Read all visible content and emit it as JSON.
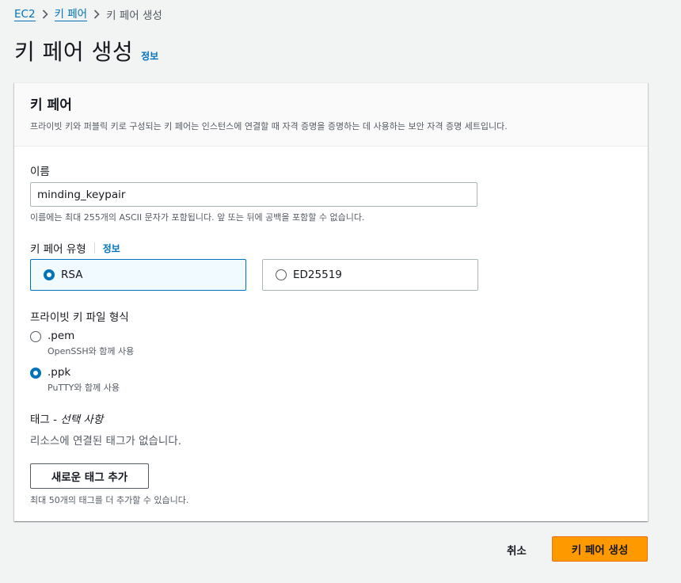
{
  "breadcrumb": {
    "root": "EC2",
    "parent": "키 페어",
    "current": "키 페어 생성"
  },
  "page": {
    "title": "키 페어 생성",
    "info": "정보"
  },
  "section": {
    "title": "키 페어",
    "description": "프라이빗 키와 퍼블릭 키로 구성되는 키 페어는 인스턴스에 연결할 때 자격 증명을 증명하는 데 사용하는 보안 자격 증명 세트입니다."
  },
  "name_field": {
    "label": "이름",
    "value": "minding_keypair",
    "hint": "이름에는 최대 255개의 ASCII 문자가 포함됩니다. 앞 또는 뒤에 공백을 포함할 수 없습니다."
  },
  "key_type": {
    "label": "키 페어 유형",
    "info": "정보",
    "options": [
      "RSA",
      "ED25519"
    ],
    "selected": "RSA"
  },
  "file_format": {
    "label": "프라이빗 키 파일 형식",
    "options": [
      {
        "label": ".pem",
        "sub": "OpenSSH와 함께 사용"
      },
      {
        "label": ".ppk",
        "sub": "PuTTY와 함께 사용"
      }
    ],
    "selected": ".ppk"
  },
  "tags": {
    "label": "태그 - ",
    "label_optional": "선택 사항",
    "empty": "리소스에 연결된 태그가 없습니다.",
    "add_button": "새로운 태그 추가",
    "limit": "최대 50개의 태그를 더 추가할 수 있습니다."
  },
  "footer": {
    "cancel": "취소",
    "submit": "키 페어 생성"
  },
  "colors": {
    "accent": "#0073bb",
    "primary_button": "#ff9900"
  }
}
